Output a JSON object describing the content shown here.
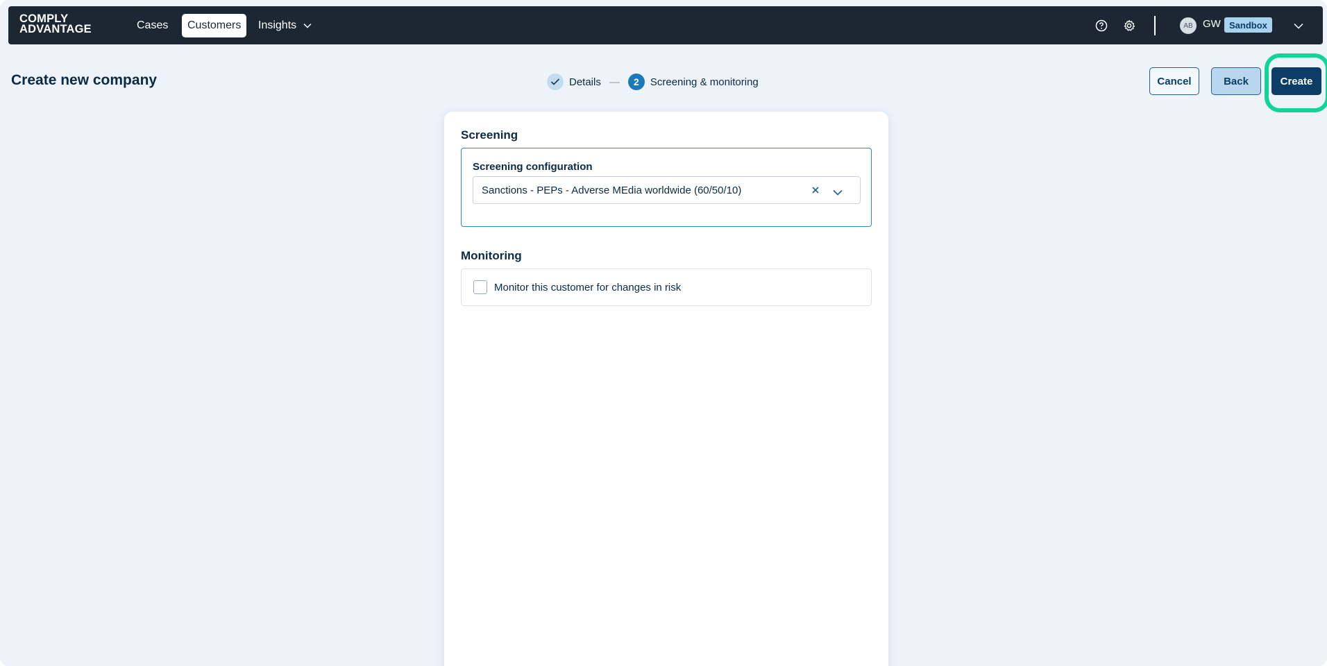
{
  "brand": {
    "line1": "COMPLY",
    "line2": "ADVANTAGE"
  },
  "nav": {
    "items": [
      {
        "label": "Cases"
      },
      {
        "label": "Customers",
        "active": true
      },
      {
        "label": "Insights",
        "has_dropdown": true
      }
    ],
    "icons": [
      "help-icon",
      "gear-icon",
      "chevron-down-icon"
    ],
    "user": {
      "avatar": "AB",
      "initials": "GW",
      "environment": "Sandbox"
    }
  },
  "page": {
    "title": "Create new company",
    "steps": [
      {
        "label": "Details",
        "state": "done"
      },
      {
        "number": "2",
        "label": "Screening & monitoring",
        "state": "current"
      }
    ],
    "step_separator": "—",
    "actions": {
      "cancel": "Cancel",
      "back": "Back",
      "create": "Create"
    }
  },
  "screening": {
    "title": "Screening",
    "config_label": "Screening configuration",
    "config_value": "Sanctions - PEPs - Adverse MEdia worldwide (60/50/10)"
  },
  "monitoring": {
    "title": "Monitoring",
    "checkbox_label": "Monitor this customer for changes in risk",
    "checked": false
  },
  "colors": {
    "nav_bg": "#1c2733",
    "page_bg": "#edf3f9",
    "primary": "#0b3d66",
    "accent": "#1d7ab8",
    "highlight": "#10d49a",
    "badge_bg": "#a8d3ee"
  }
}
